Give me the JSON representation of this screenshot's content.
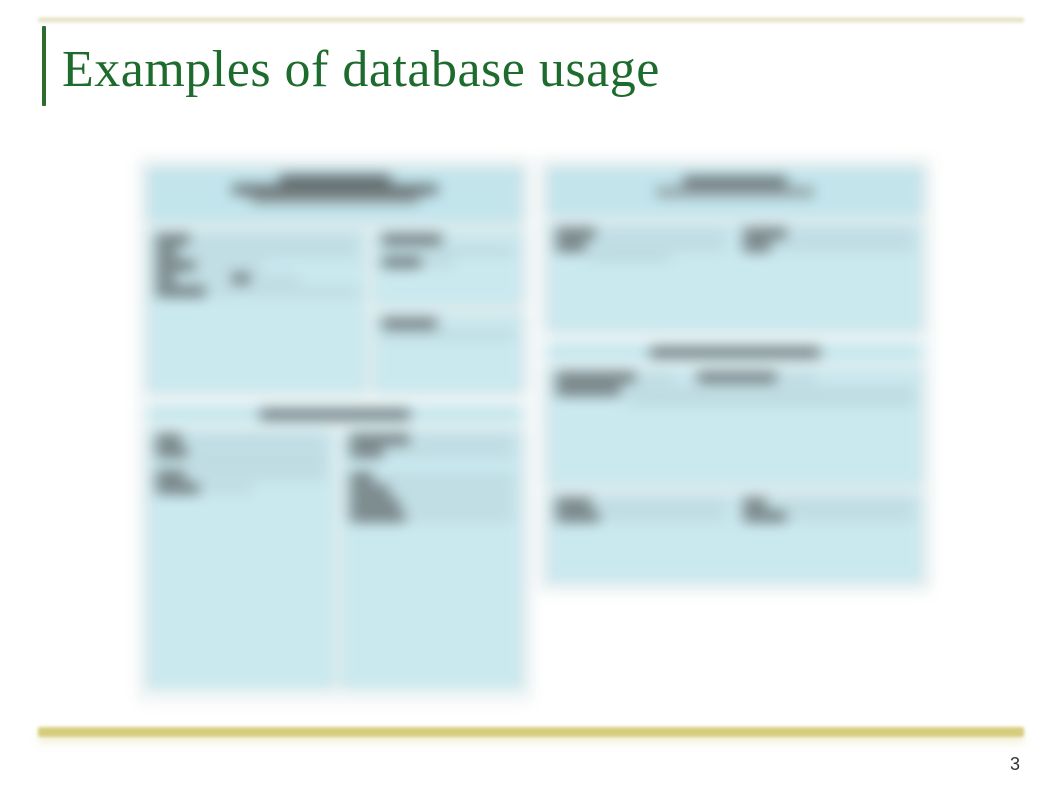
{
  "title": "Examples of database usage",
  "page_number": "3",
  "colors": {
    "title_color": "#1e6b2e",
    "accent_rule": "#cdbf6e",
    "form_panel_bg": "#c8e8ef",
    "form_border": "#8faeb4"
  },
  "content": {
    "description": "Blurred preview of two side-by-side database form screenshots (content illegible).",
    "forms": [
      {
        "position": "left",
        "header_lines": 3,
        "sections": [
          {
            "rows": 6,
            "columns": 2
          },
          {
            "subtitle_present": true,
            "rows": 5,
            "columns": 2
          }
        ]
      },
      {
        "position": "right",
        "header_lines": 2,
        "sections": [
          {
            "rows": 3,
            "columns": 2
          },
          {
            "subtitle_present": true,
            "rows": 3,
            "columns": 2
          },
          {
            "rows": 2,
            "columns": 2
          }
        ]
      }
    ]
  }
}
